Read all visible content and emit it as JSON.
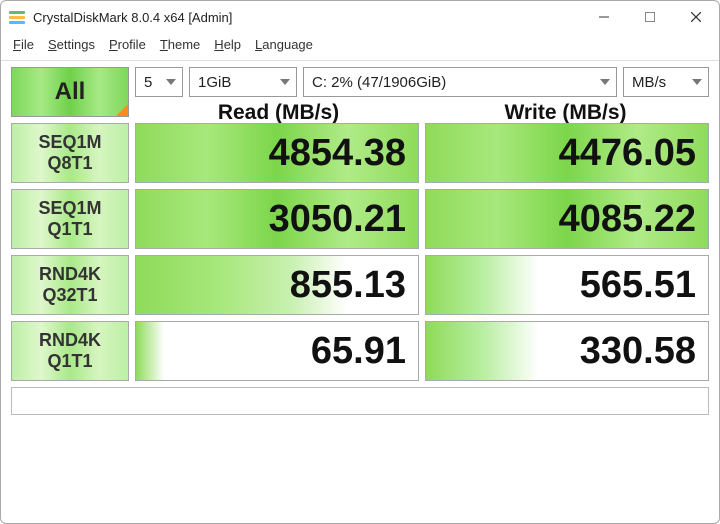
{
  "window": {
    "title": "CrystalDiskMark 8.0.4 x64 [Admin]"
  },
  "menu": {
    "file": "File",
    "settings": "Settings",
    "profile": "Profile",
    "theme": "Theme",
    "help": "Help",
    "language": "Language"
  },
  "controls": {
    "all_label": "All",
    "count": "5",
    "size": "1GiB",
    "drive": "C: 2% (47/1906GiB)",
    "unit": "MB/s"
  },
  "headers": {
    "read": "Read (MB/s)",
    "write": "Write (MB/s)"
  },
  "tests": [
    {
      "label1": "SEQ1M",
      "label2": "Q8T1",
      "read": "4854.38",
      "write": "4476.05",
      "read_class": "",
      "write_class": ""
    },
    {
      "label1": "SEQ1M",
      "label2": "Q1T1",
      "read": "3050.21",
      "write": "4085.22",
      "read_class": "",
      "write_class": ""
    },
    {
      "label1": "RND4K",
      "label2": "Q32T1",
      "read": "855.13",
      "write": "565.51",
      "read_class": "med",
      "write_class": "low"
    },
    {
      "label1": "RND4K",
      "label2": "Q1T1",
      "read": "65.91",
      "write": "330.58",
      "read_class": "vlow",
      "write_class": "low"
    }
  ]
}
